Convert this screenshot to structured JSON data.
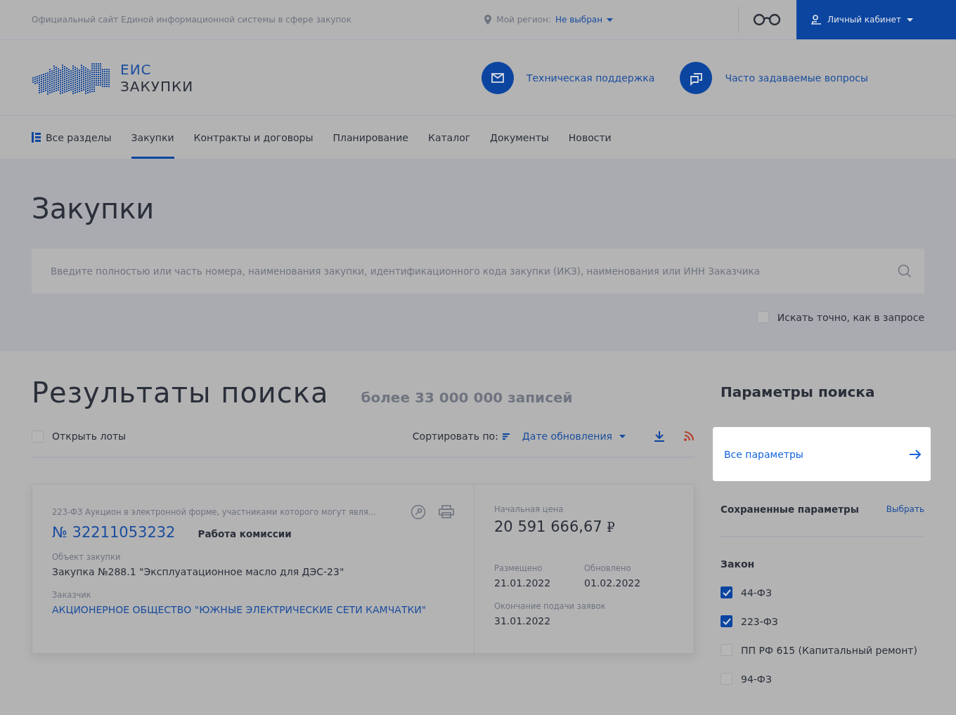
{
  "top_bar": {
    "site_title": "Официальный сайт Единой информационной системы в сфере закупок",
    "region_label": "Мой регион:",
    "region_value": "Не выбран",
    "account": "Личный кабинет"
  },
  "header": {
    "logo_line1": "ЕИС",
    "logo_line2": "ЗАКУПКИ",
    "links": [
      {
        "label": "Техническая поддержка",
        "kind": "mail"
      },
      {
        "label": "Часто задаваемые вопросы",
        "kind": "faq"
      }
    ]
  },
  "nav": [
    {
      "label": "Все разделы",
      "kind": "all",
      "selected": false
    },
    {
      "label": "Закупки",
      "kind": "tab",
      "selected": true
    },
    {
      "label": "Контракты и договоры",
      "kind": "tab",
      "selected": false
    },
    {
      "label": "Планирование",
      "kind": "tab",
      "selected": false
    },
    {
      "label": "Каталог",
      "kind": "tab",
      "selected": false
    },
    {
      "label": "Документы",
      "kind": "tab",
      "selected": false
    },
    {
      "label": "Новости",
      "kind": "tab",
      "selected": false
    }
  ],
  "hero": {
    "title": "Закупки",
    "search": {
      "placeholder": "Введите полностью или часть номера, наименования закупки, идентификационного кода закупки (ИКЗ), наименования или ИНН Заказчика"
    },
    "exact": {
      "label": "Искать точно, как в запросе",
      "checked": false
    }
  },
  "results": {
    "title": "Результаты поиска",
    "count": "более 33 000 000 записей",
    "open_lots": {
      "label": "Открыть лоты",
      "checked": false
    },
    "sort_label": "Сортировать по:",
    "sort_value": "Дате обновления",
    "cards": [
      {
        "type_line": "223-ФЗ Аукцион в электронной форме, участниками которого могут явля...",
        "number": "№ 32211053232",
        "status": "Работа комиссии",
        "object_label": "Объект закупки",
        "object": "Закупка №288.1 \"Эксплуатационное масло для ДЭС-23\"",
        "customer_label": "Заказчик",
        "customer": "АКЦИОНЕРНОЕ ОБЩЕСТВО \"ЮЖНЫЕ ЭЛЕКТРИЧЕСКИЕ СЕТИ КАМЧАТКИ\"",
        "price_label": "Начальная цена",
        "price": "20 591 666,67",
        "currency": "₽",
        "posted_label": "Размещено",
        "posted": "21.01.2022",
        "updated_label": "Обновлено",
        "updated": "01.02.2022",
        "deadline_label": "Окончание подачи заявок",
        "deadline": "31.01.2022"
      }
    ]
  },
  "params": {
    "title": "Параметры поиска",
    "all_params": "Все параметры",
    "saved_label": "Сохраненные параметры",
    "saved_action": "Выбрать",
    "law_title": "Закон",
    "laws": [
      {
        "label": "44-ФЗ",
        "checked": true
      },
      {
        "label": "223-ФЗ",
        "checked": true
      },
      {
        "label": "ПП РФ 615 (Капитальный ремонт)",
        "checked": false
      },
      {
        "label": "94-ФЗ",
        "checked": false
      }
    ]
  }
}
